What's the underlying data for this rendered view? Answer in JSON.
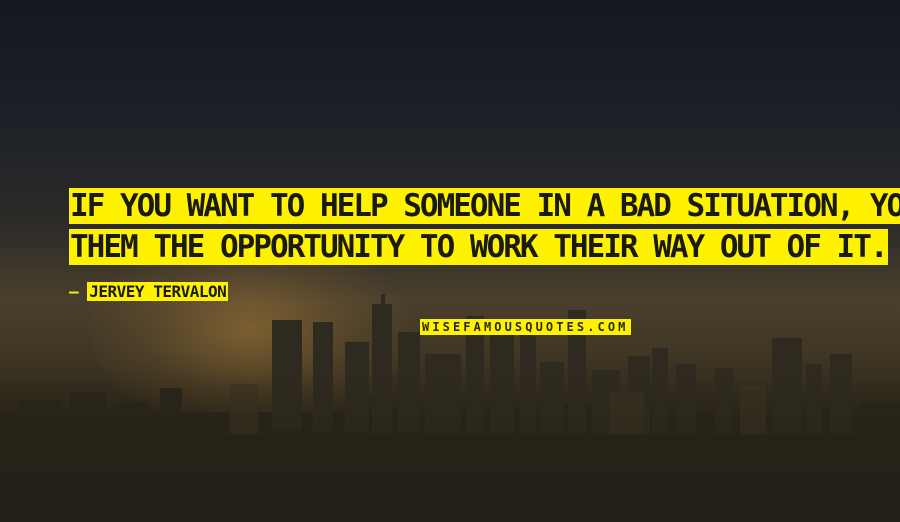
{
  "quote": {
    "line1": "IF YOU WANT TO HELP SOMEONE IN A BAD SITUATION, YOU NEED TO GIVE",
    "line2": "THEM THE OPPORTUNITY TO WORK THEIR WAY OUT OF IT."
  },
  "author": {
    "dash": "— ",
    "name": "JERVEY TERVALON"
  },
  "watermark": "WISEFAMOUSQUOTES.COM",
  "colors": {
    "highlight": "#fff200",
    "text_on_highlight": "#1a1a10"
  }
}
